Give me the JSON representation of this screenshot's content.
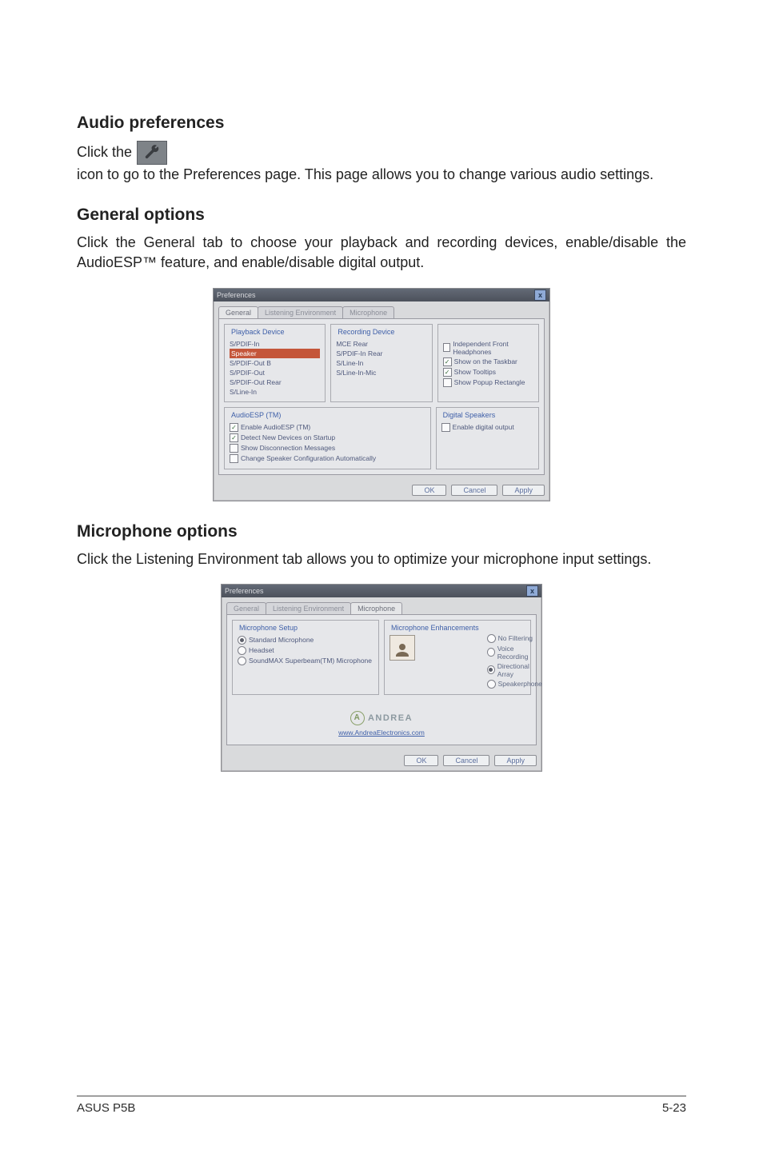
{
  "sections": {
    "audio_pref_heading": "Audio preferences",
    "audio_pref_text_a": "Click the",
    "audio_pref_text_b": "icon to go to the Preferences page. This page allows you to change various audio settings.",
    "icon_name": "wrench-icon",
    "general_heading": "General options",
    "general_text": "Click the General tab to choose your playback and recording devices, enable/disable the AudioESP™ feature, and enable/disable digital output.",
    "mic_heading": "Microphone options",
    "mic_text": "Click the Listening Environment tab allows you to optimize your microphone input settings."
  },
  "win1": {
    "title": "Preferences",
    "close": "x",
    "tabs": [
      "General",
      "Listening Environment",
      "Microphone"
    ],
    "active_tab": 0,
    "groups": {
      "playback": {
        "title": "Playback Device",
        "items": [
          "S/PDIF-In",
          "Speaker",
          "S/PDIF-Out B",
          "S/PDIF-Out",
          "S/PDIF-Out Rear",
          "S/Line-In"
        ],
        "selected_index": 1
      },
      "recording": {
        "title": "Recording Device",
        "items": [
          "MCE Rear",
          "S/PDIF-In Rear",
          "S/Line-In",
          "S/Line-In-Mic"
        ]
      },
      "other": {
        "title": "",
        "checks": [
          {
            "label": "Independent Front Headphones",
            "checked": false
          },
          {
            "label": "Show on the Taskbar",
            "checked": true
          },
          {
            "label": "Show Tooltips",
            "checked": true
          },
          {
            "label": "Show Popup Rectangle",
            "checked": false
          }
        ]
      },
      "audio_esp": {
        "title": "AudioESP (TM)",
        "checks": [
          {
            "label": "Enable AudioESP (TM)",
            "checked": true
          },
          {
            "label": "Detect New Devices on Startup",
            "checked": true
          },
          {
            "label": "Show Disconnection Messages",
            "checked": false
          },
          {
            "label": "Change Speaker Configuration Automatically",
            "checked": false
          }
        ]
      },
      "digital_out": {
        "title": "Digital Speakers",
        "checks": [
          {
            "label": "Enable digital output",
            "checked": false
          }
        ]
      }
    },
    "buttons": [
      "OK",
      "Cancel",
      "Apply"
    ]
  },
  "win2": {
    "title": "Preferences",
    "close": "x",
    "tabs": [
      "General",
      "Listening Environment",
      "Microphone"
    ],
    "active_tab": 2,
    "group_setup": {
      "title": "Microphone Setup",
      "radios": [
        {
          "label": "Standard Microphone",
          "on": true
        },
        {
          "label": "Headset",
          "on": false
        },
        {
          "label": "SoundMAX Superbeam(TM) Microphone",
          "on": false
        }
      ]
    },
    "group_enh": {
      "title": "Microphone Enhancements",
      "radios": [
        {
          "label": "No Filtering",
          "on": false
        },
        {
          "label": "Voice Recording",
          "on": false
        },
        {
          "label": "Directional Array",
          "on": true
        },
        {
          "label": "Speakerphone",
          "on": false
        }
      ]
    },
    "andrea_text": "ANDREA",
    "andrea_link": "www.AndreaElectronics.com",
    "buttons": [
      "OK",
      "Cancel",
      "Apply"
    ]
  },
  "footer": {
    "left": "ASUS P5B",
    "right": "5-23"
  }
}
